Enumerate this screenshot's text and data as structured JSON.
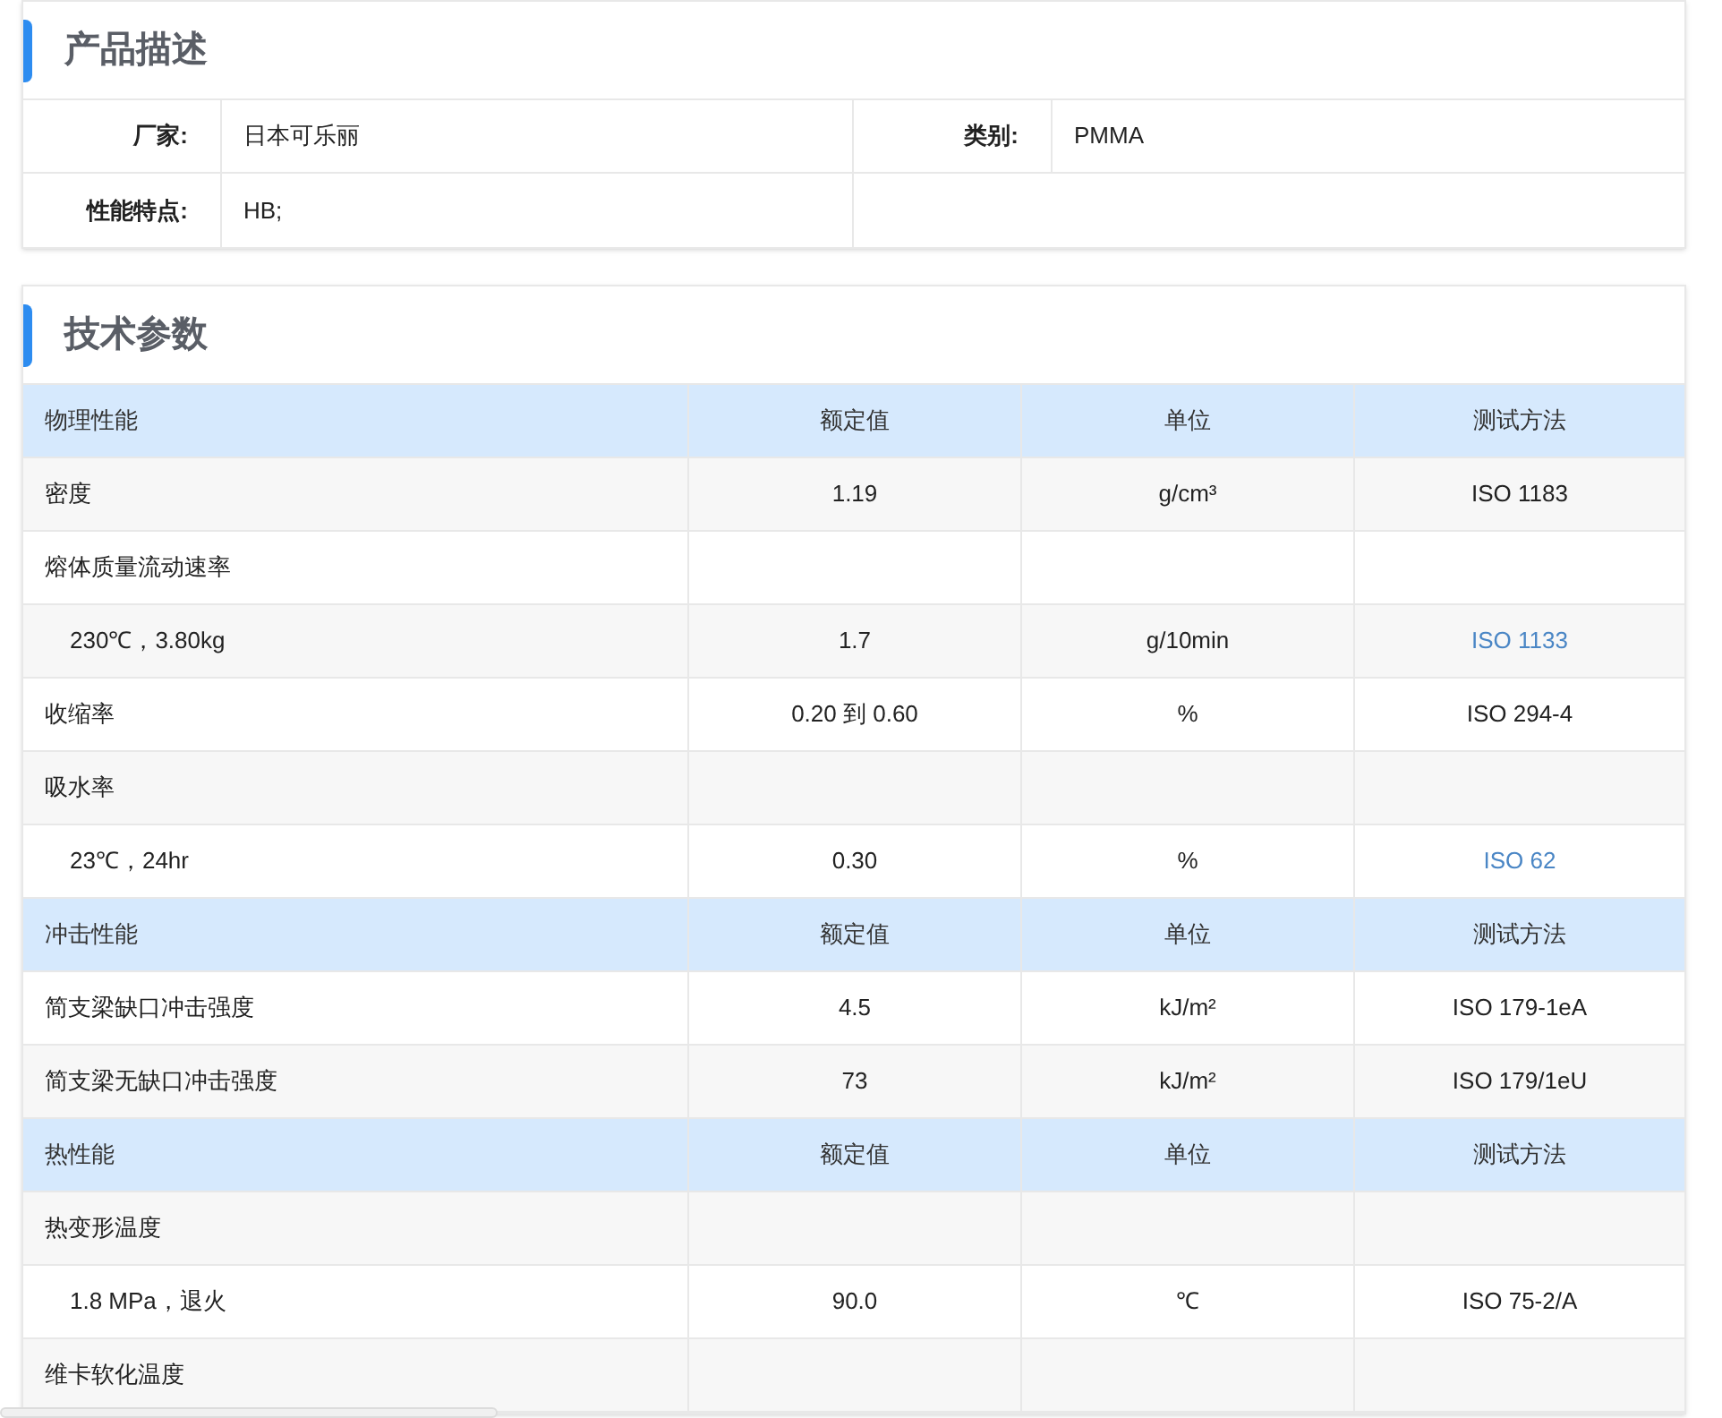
{
  "product_description": {
    "title": "产品描述",
    "fields": [
      {
        "label": "厂家:",
        "value": "日本可乐丽"
      },
      {
        "label": "类别:",
        "value": "PMMA"
      },
      {
        "label": "性能特点:",
        "value": "HB;"
      }
    ]
  },
  "technical_parameters": {
    "title": "技术参数",
    "groups": [
      {
        "header": [
          "物理性能",
          "额定值",
          "单位",
          "测试方法"
        ],
        "rows": [
          {
            "name": "密度",
            "value": "1.19",
            "unit": "g/cm³",
            "method": "ISO 1183",
            "method_is_link": false
          },
          {
            "name": "熔体质量流动速率",
            "children": [
              {
                "name": "230℃，3.80kg",
                "value": "1.7",
                "unit": "g/10min",
                "method": "ISO 1133",
                "method_is_link": true
              }
            ]
          },
          {
            "name": "收缩率",
            "value": "0.20 到 0.60",
            "unit": "%",
            "method": "ISO 294-4",
            "method_is_link": false
          },
          {
            "name": "吸水率",
            "children": [
              {
                "name": "23℃，24hr",
                "value": "0.30",
                "unit": "%",
                "method": "ISO 62",
                "method_is_link": true
              }
            ]
          }
        ]
      },
      {
        "header": [
          "冲击性能",
          "额定值",
          "单位",
          "测试方法"
        ],
        "rows": [
          {
            "name": "简支梁缺口冲击强度",
            "value": "4.5",
            "unit": "kJ/m²",
            "method": "ISO 179-1eA",
            "method_is_link": false
          },
          {
            "name": "简支梁无缺口冲击强度",
            "value": "73",
            "unit": "kJ/m²",
            "method": "ISO 179/1eU",
            "method_is_link": false
          }
        ]
      },
      {
        "header": [
          "热性能",
          "额定值",
          "单位",
          "测试方法"
        ],
        "rows": [
          {
            "name": "热变形温度",
            "children": [
              {
                "name": "1.8 MPa，退火",
                "value": "90.0",
                "unit": "℃",
                "method": "ISO 75-2/A",
                "method_is_link": false
              }
            ]
          },
          {
            "name": "维卡软化温度"
          }
        ]
      }
    ]
  }
}
